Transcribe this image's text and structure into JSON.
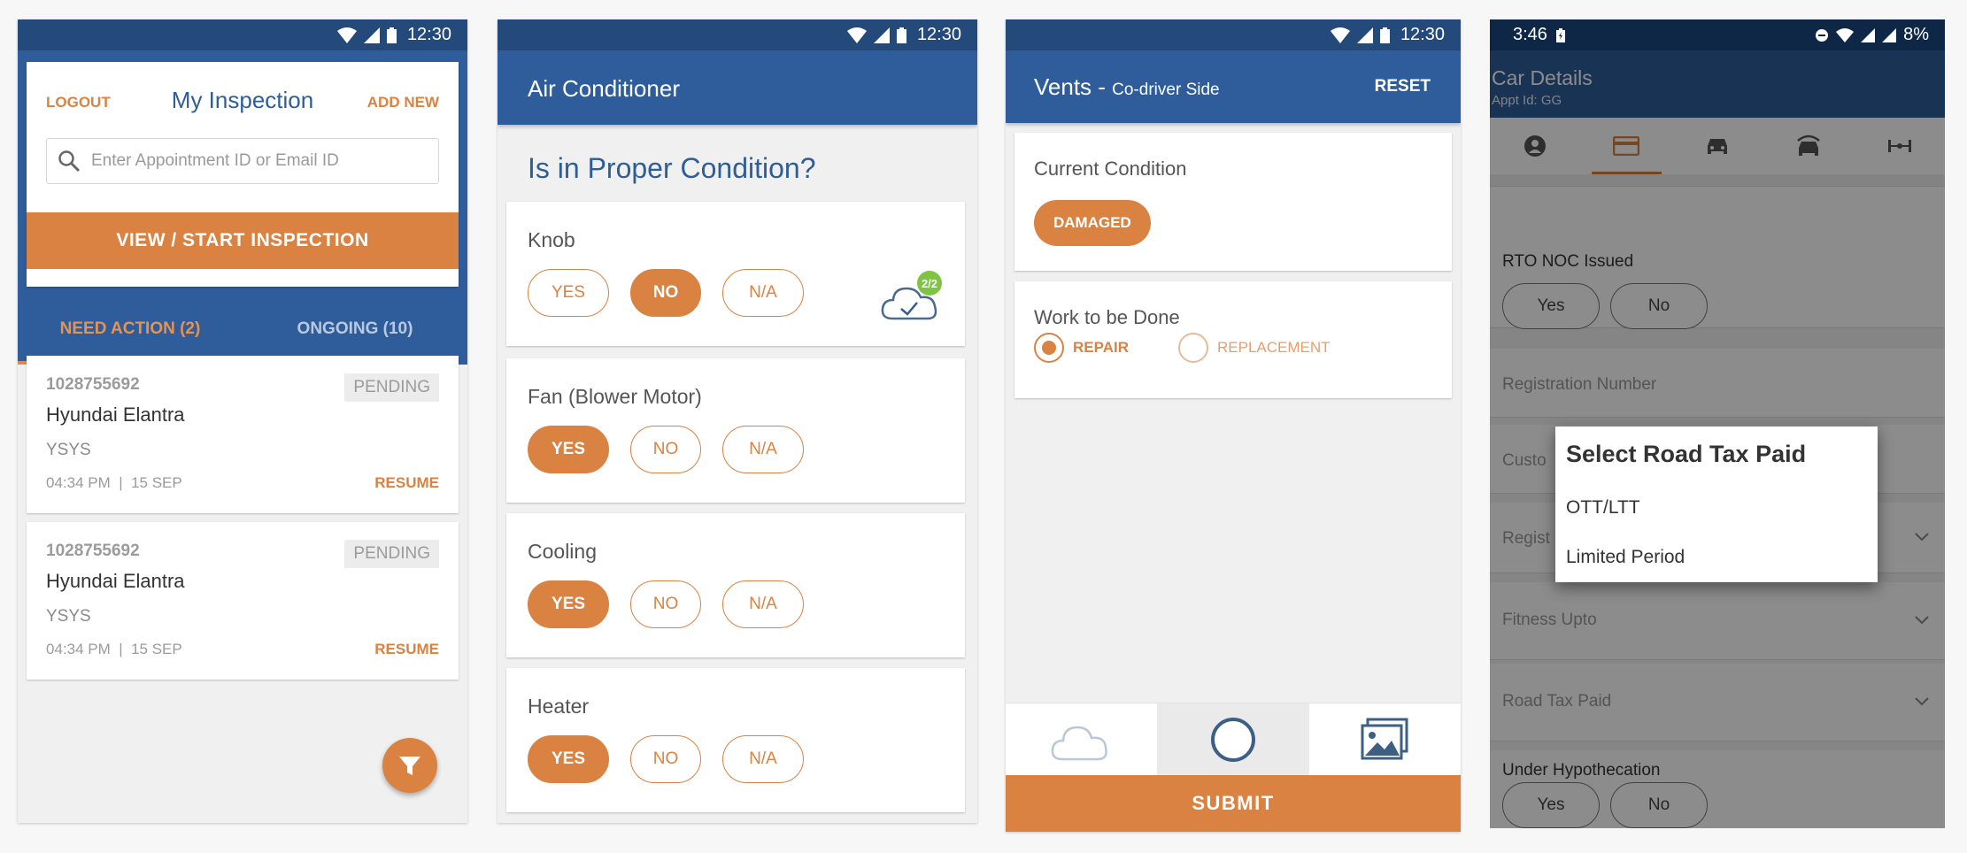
{
  "status_bar": {
    "time": "12:30"
  },
  "screen1": {
    "logout": "LOGOUT",
    "title": "My Inspection",
    "add_new": "ADD NEW",
    "search_placeholder": "Enter Appointment ID or Email ID",
    "view_button": "VIEW / START INSPECTION",
    "tabs": [
      {
        "label": "NEED ACTION (2)",
        "active": true
      },
      {
        "label": "ONGOING (10)",
        "active": false
      }
    ],
    "items": [
      {
        "id": "1028755692",
        "status": "PENDING",
        "car": "Hyundai Elantra",
        "owner": "YSYS",
        "time": "04:34 PM",
        "date": "15 SEP",
        "action": "RESUME"
      },
      {
        "id": "1028755692",
        "status": "PENDING",
        "car": "Hyundai Elantra",
        "owner": "YSYS",
        "time": "04:34 PM",
        "date": "15 SEP",
        "action": "RESUME"
      }
    ],
    "fab_icon": "filter-icon"
  },
  "screen2": {
    "title": "Air Conditioner",
    "question": "Is in Proper Condition?",
    "cloud_badge": "2/2",
    "rows": [
      {
        "label": "Knob",
        "options": [
          "YES",
          "NO",
          "N/A"
        ],
        "selected": "NO"
      },
      {
        "label": "Fan (Blower Motor)",
        "options": [
          "YES",
          "NO",
          "N/A"
        ],
        "selected": "YES"
      },
      {
        "label": "Cooling",
        "options": [
          "YES",
          "NO",
          "N/A"
        ],
        "selected": "YES"
      },
      {
        "label": "Heater",
        "options": [
          "YES",
          "NO",
          "N/A"
        ],
        "selected": "YES"
      }
    ]
  },
  "screen3": {
    "title": "Vents -",
    "subtitle": "Co-driver Side",
    "reset": "RESET",
    "current_condition_label": "Current Condition",
    "current_condition_value": "DAMAGED",
    "work_label": "Work to be Done",
    "work_options": [
      {
        "label": "REPAIR",
        "selected": true
      },
      {
        "label": "REPLACEMENT",
        "selected": false
      }
    ],
    "submit": "SUBMIT"
  },
  "screen4": {
    "status_time": "3:46",
    "battery": "8%",
    "title": "Car Details",
    "subtitle": "Appt Id: GG",
    "rto_label": "RTO NOC Issued",
    "yes": "Yes",
    "no": "No",
    "registration_number": "Registration Number",
    "customer_partial": "Custo",
    "registration_partial": "Regist",
    "fitness_upto": "Fitness Upto",
    "road_tax_paid": "Road Tax Paid",
    "under_hypothecation": "Under Hypothecation",
    "dialog": {
      "title": "Select Road Tax Paid",
      "options": [
        "OTT/LTT",
        "Limited Period"
      ]
    }
  },
  "colors": {
    "primary": "#2f5d9b",
    "accent": "#d98242",
    "status_bar": "#244a7c"
  }
}
